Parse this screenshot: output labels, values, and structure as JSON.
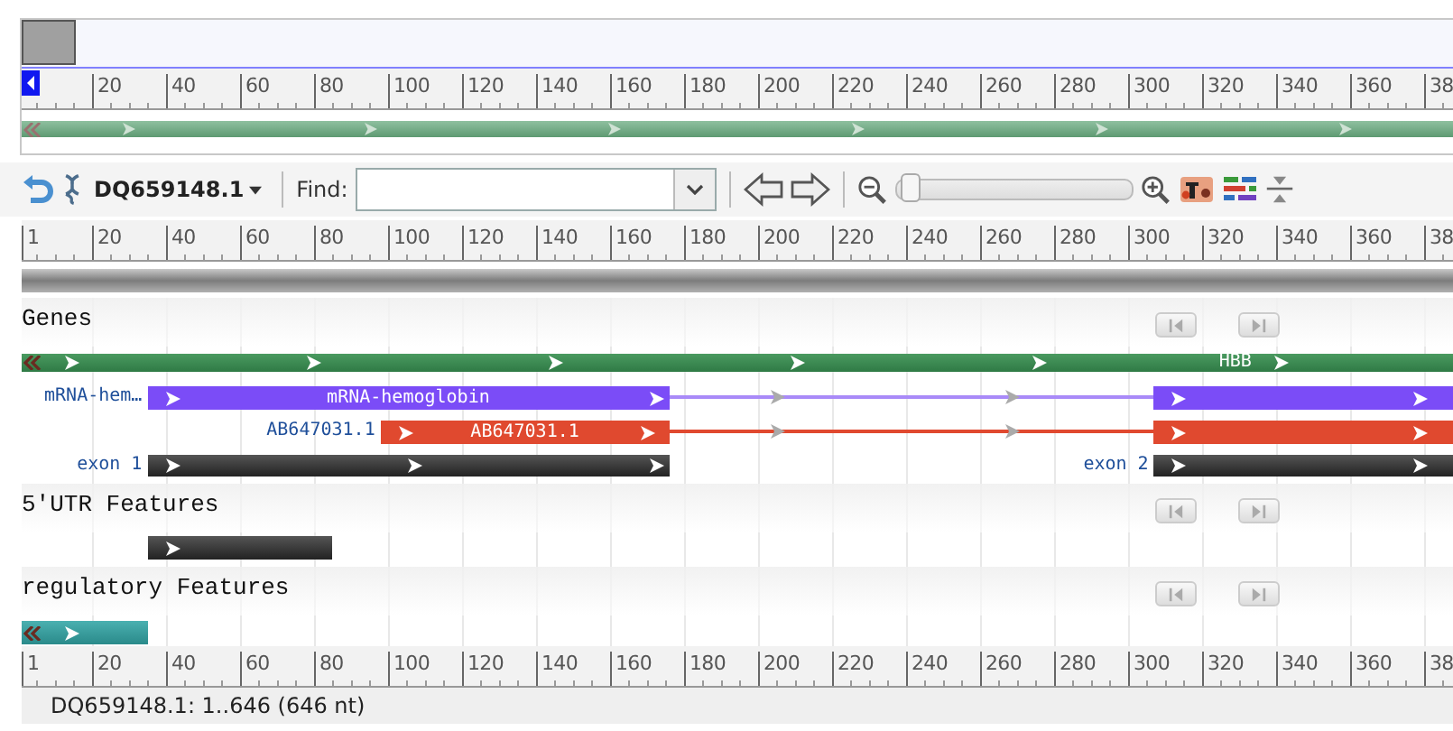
{
  "overview": {
    "ruler": {
      "labels": [
        "20",
        "40",
        "60",
        "80",
        "100",
        "120",
        "140",
        "160",
        "180",
        "200",
        "220",
        "240",
        "260",
        "280",
        "300",
        "320",
        "340",
        "360",
        "38"
      ]
    }
  },
  "toolbar": {
    "sequence": "DQ659148.1",
    "find_label": "Find:",
    "zoom_slider": {
      "level": 0.02
    }
  },
  "ruler": {
    "labels": [
      "1",
      "20",
      "40",
      "60",
      "80",
      "100",
      "120",
      "140",
      "160",
      "180",
      "200",
      "220",
      "240",
      "260",
      "280",
      "300",
      "320",
      "340",
      "360",
      "38"
    ]
  },
  "tracks": [
    {
      "title": "Genes",
      "rows": [
        [
          {
            "kind": "gene",
            "label": "HBB",
            "continues_left": true
          }
        ],
        [
          {
            "kind": "mrna",
            "side_label": "mRNA-hem…",
            "label": "mRNA-hemoglobin",
            "continues_left": false
          }
        ],
        [
          {
            "kind": "alignment",
            "side_label": "AB647031.1",
            "label": "AB647031.1",
            "continues_left": false
          }
        ],
        [
          {
            "kind": "exon",
            "side_label": "exon 1",
            "continues_left": false
          },
          {
            "kind": "exon",
            "side_label": "exon 2",
            "continues_left": false
          }
        ]
      ]
    },
    {
      "title": "5'UTR Features",
      "rows": [
        [
          {
            "kind": "utr",
            "continues_left": false
          }
        ]
      ]
    },
    {
      "title": "regulatory Features",
      "rows": [
        [
          {
            "kind": "regulatory",
            "continues_left": true
          }
        ]
      ]
    }
  ],
  "bottom_ruler": {
    "labels": [
      "1",
      "20",
      "40",
      "60",
      "80",
      "100",
      "120",
      "140",
      "160",
      "180",
      "200",
      "220",
      "240",
      "260",
      "280",
      "300",
      "320",
      "340",
      "360",
      "38"
    ]
  },
  "status_bar": "DQ659148.1: 1..646 (646 nt)"
}
